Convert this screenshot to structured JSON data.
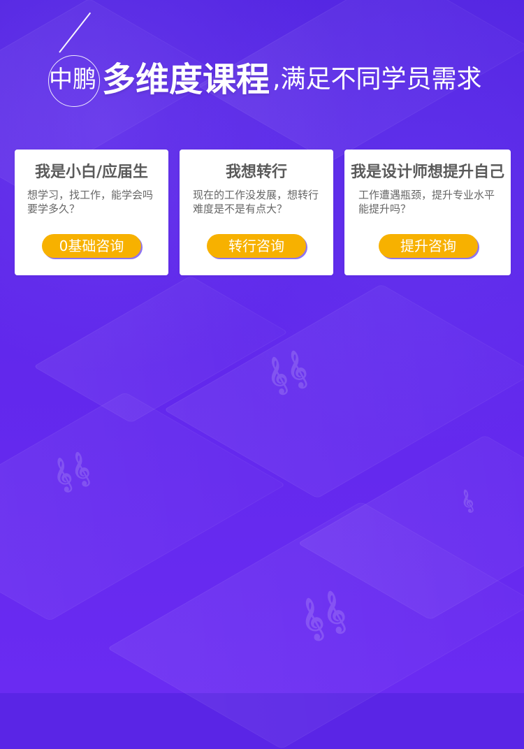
{
  "header": {
    "brand": "中鹏",
    "main": "多维度课程",
    "sub": ",满足不同学员需求"
  },
  "cards": [
    {
      "title": "我是小白/应届生",
      "description": "想学习，找工作，能学会吗\n要学多久？",
      "button": "0基础咨询"
    },
    {
      "title": "我想转行",
      "description": "现在的工作没发展，想转行\n难度是不是有点大？",
      "button": "转行咨询"
    },
    {
      "title": "我是设计师想提升自己",
      "description": "工作遭遇瓶颈，提升专业水平\n能提升吗？",
      "button": "提升咨询"
    }
  ],
  "colors": {
    "background": "#5a25e6",
    "card": "#ffffff",
    "button": "#f7b100",
    "button_shadow": "#8e74f0",
    "card_title": "#5a5a5a",
    "card_text": "#666666"
  }
}
